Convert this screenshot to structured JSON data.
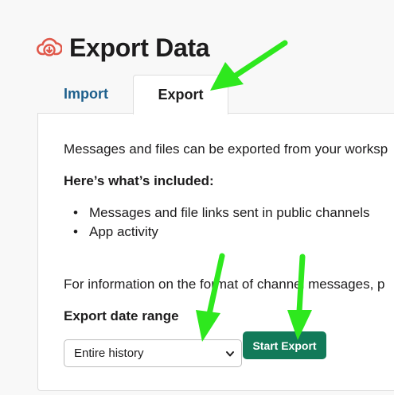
{
  "header": {
    "title": "Export Data",
    "icon": "cloud-download-icon",
    "icon_color": "#e0584a"
  },
  "tabs": [
    {
      "label": "Import",
      "active": false
    },
    {
      "label": "Export",
      "active": true
    }
  ],
  "content": {
    "description": "Messages and files can be exported from your worksp",
    "included_heading": "Here’s what’s included:",
    "included_items": [
      "Messages and file links sent in public channels",
      "App activity"
    ],
    "info_text": "For information on the format of channel messages, p",
    "date_range_label": "Export date range",
    "date_range_selected": "Entire history",
    "start_button": "Start Export"
  },
  "colors": {
    "accent_button": "#127a59",
    "tab_link": "#1d5f8c",
    "annotation_arrow": "#2ee81e"
  }
}
